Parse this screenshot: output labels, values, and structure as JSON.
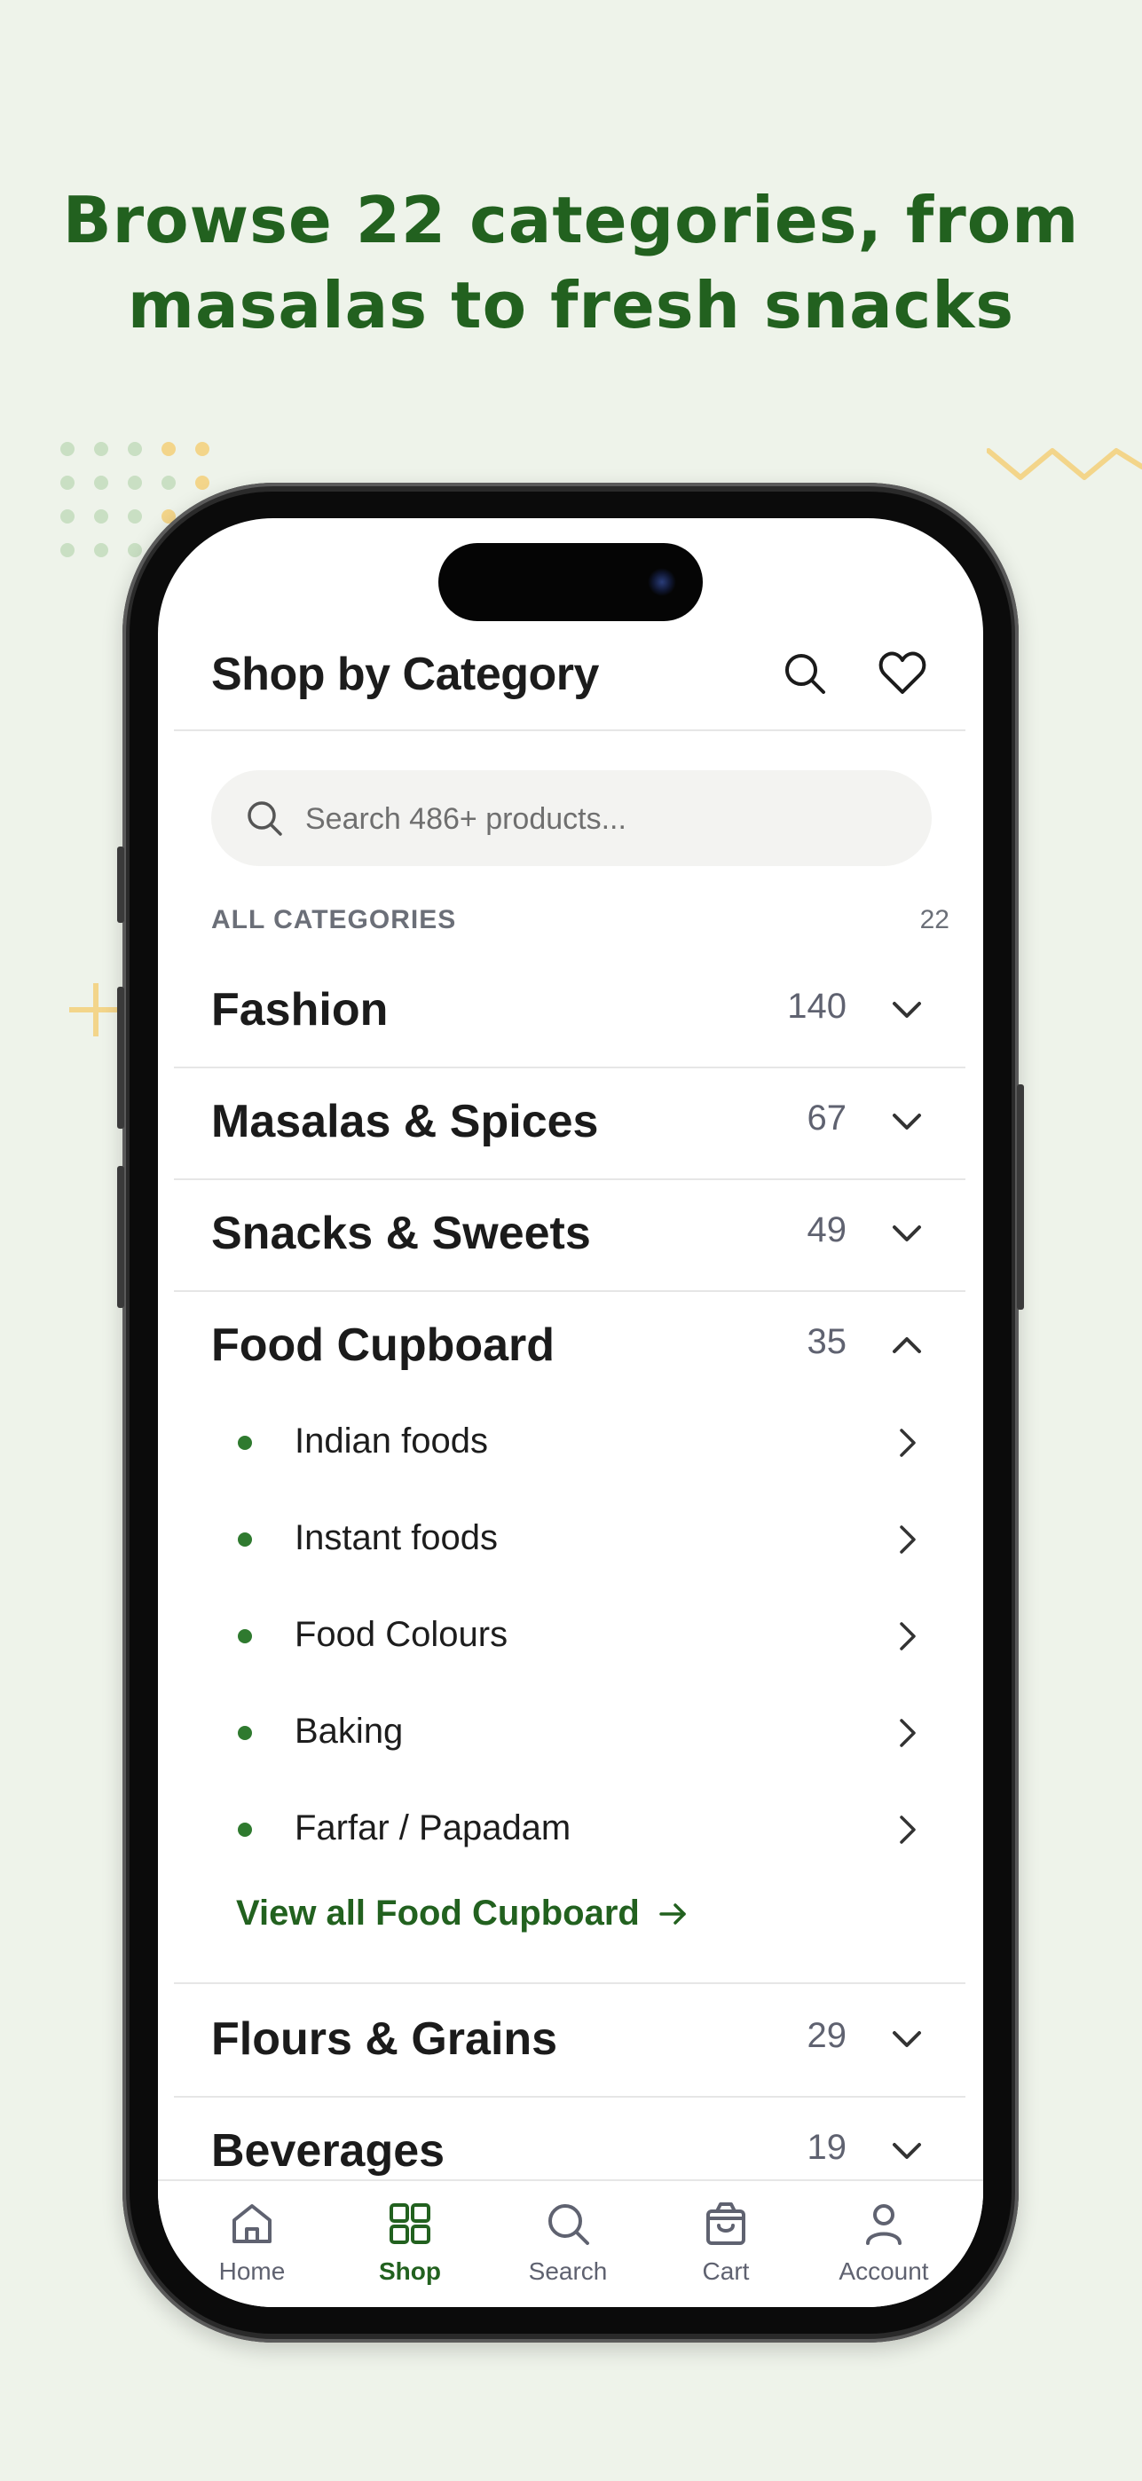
{
  "headline": {
    "line1": "Browse 22 categories, from",
    "line2": "masalas to fresh snacks"
  },
  "colors": {
    "brand_green": "#22611f",
    "accent_yellow": "#f3d58a",
    "background": "#eef3ea"
  },
  "header": {
    "title": "Shop by Category",
    "search_icon": "search-icon",
    "favorites_icon": "heart-icon"
  },
  "search": {
    "placeholder": "Search 486+ products..."
  },
  "section": {
    "label": "ALL CATEGORIES",
    "count": "22"
  },
  "categories": [
    {
      "name": "Fashion",
      "count": "140",
      "expanded": false
    },
    {
      "name": "Masalas & Spices",
      "count": "67",
      "expanded": false
    },
    {
      "name": "Snacks & Sweets",
      "count": "49",
      "expanded": false
    },
    {
      "name": "Food Cupboard",
      "count": "35",
      "expanded": true,
      "subcategories": [
        "Indian foods",
        "Instant foods",
        "Food Colours",
        "Baking",
        "Farfar / Papadam"
      ],
      "view_all": "View all Food Cupboard"
    },
    {
      "name": "Flours & Grains",
      "count": "29",
      "expanded": false
    },
    {
      "name": "Beverages",
      "count": "19",
      "expanded": false
    }
  ],
  "tabs": [
    {
      "label": "Home",
      "icon": "home-icon",
      "active": false
    },
    {
      "label": "Shop",
      "icon": "grid-icon",
      "active": true
    },
    {
      "label": "Search",
      "icon": "search-icon",
      "active": false
    },
    {
      "label": "Cart",
      "icon": "shopping-bag-icon",
      "active": false
    },
    {
      "label": "Account",
      "icon": "user-icon",
      "active": false
    }
  ]
}
